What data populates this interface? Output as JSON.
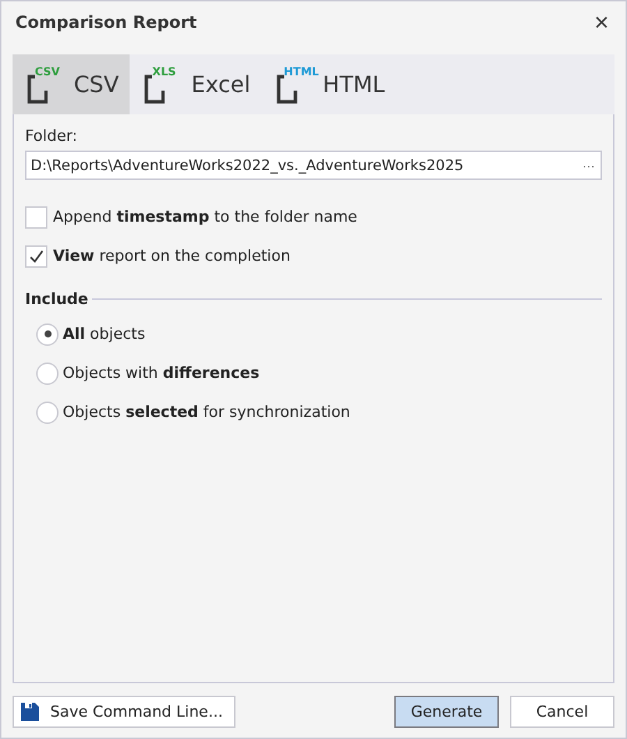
{
  "window": {
    "title": "Comparison Report",
    "close": "×"
  },
  "tabs": [
    {
      "label": "CSV",
      "badge": "CSV",
      "color": "#2e9e3e",
      "selected": true
    },
    {
      "label": "Excel",
      "badge": "XLS",
      "color": "#2e9e3e",
      "selected": false
    },
    {
      "label": "HTML",
      "badge": "HTML",
      "color": "#1e9ad6",
      "selected": false
    }
  ],
  "folder": {
    "label": "Folder:",
    "value": "D:\\Reports\\AdventureWorks2022_vs._AdventureWorks2025",
    "browse": "···"
  },
  "options": [
    {
      "label": "Append **timestamp** to the folder name",
      "checked": false
    },
    {
      "label": "**View** report on the completion",
      "checked": true
    }
  ],
  "include": {
    "title": "Include",
    "choices": [
      {
        "label": "**All** objects",
        "selected": true
      },
      {
        "label": "Objects with **differences**",
        "selected": false
      },
      {
        "label": "Objects **selected** for synchronization",
        "selected": false
      }
    ]
  },
  "buttons": {
    "save": "Save Command Line...",
    "generate": "Generate",
    "cancel": "Cancel"
  }
}
